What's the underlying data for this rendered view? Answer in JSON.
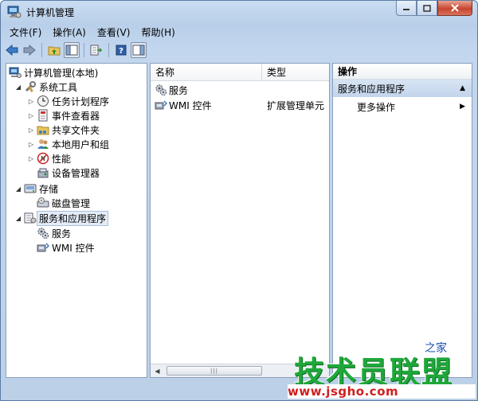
{
  "window": {
    "title": "计算机管理"
  },
  "menu": [
    "文件(F)",
    "操作(A)",
    "查看(V)",
    "帮助(H)"
  ],
  "toolbar": {
    "buttons": [
      "back-icon",
      "forward-icon",
      "up-folder-icon",
      "show-hide-tree-icon",
      "export-list-icon",
      "help-icon",
      "show-hide-action-pane-icon"
    ]
  },
  "tree": {
    "root": "计算机管理(本地)",
    "system_tools": "系统工具",
    "task_scheduler": "任务计划程序",
    "event_viewer": "事件查看器",
    "shared_folders": "共享文件夹",
    "local_users": "本地用户和组",
    "performance": "性能",
    "device_manager": "设备管理器",
    "storage": "存储",
    "disk_management": "磁盘管理",
    "services_apps": "服务和应用程序",
    "services": "服务",
    "wmi": "WMI 控件"
  },
  "list": {
    "col_name": "名称",
    "col_type": "类型",
    "rows": [
      {
        "name": "服务",
        "type": ""
      },
      {
        "name": "WMI 控件",
        "type": "扩展管理单元"
      }
    ]
  },
  "actions": {
    "header": "操作",
    "section": "服务和应用程序",
    "more": "更多操作"
  },
  "watermark": {
    "main": "技术员联盟",
    "url": "www.jsgho.com",
    "site": "之家"
  },
  "colors": {
    "accent": "#1fa83a",
    "url": "#d01f1f",
    "selection": "#e3ecf7"
  }
}
